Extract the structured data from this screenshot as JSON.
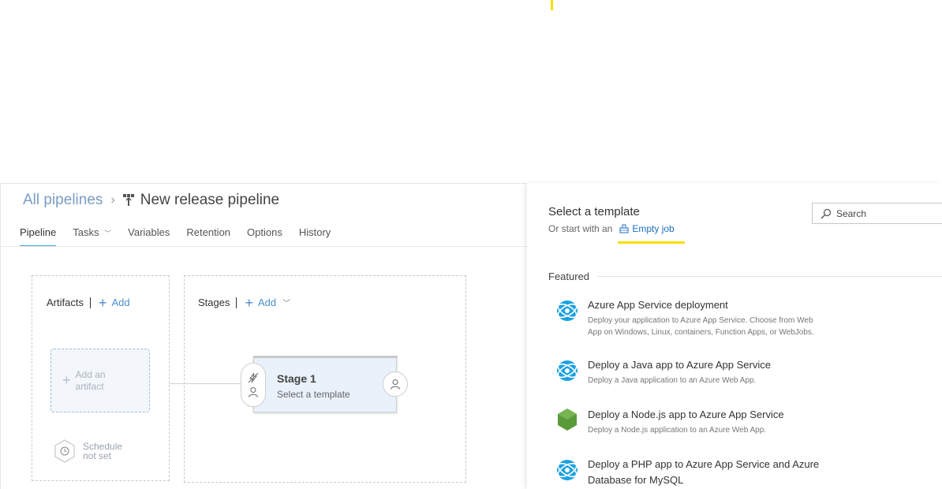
{
  "breadcrumb": {
    "root": "All pipelines",
    "separator": "›",
    "title": "New release pipeline"
  },
  "tabs": [
    {
      "label": "Pipeline",
      "active": true
    },
    {
      "label": "Tasks",
      "active": false
    },
    {
      "label": "Variables",
      "active": false
    },
    {
      "label": "Retention",
      "active": false
    },
    {
      "label": "Options",
      "active": false
    },
    {
      "label": "History",
      "active": false
    }
  ],
  "artifacts": {
    "heading": "Artifacts",
    "add_label": "Add",
    "card_line1": "Add an",
    "card_line2": "artifact",
    "schedule_line1": "Schedule",
    "schedule_line2": "not set"
  },
  "stages": {
    "heading": "Stages",
    "add_label": "Add",
    "stage_name": "Stage 1",
    "stage_sub": "Select a template"
  },
  "template_panel": {
    "title": "Select a template",
    "start_text": "Or start with an",
    "empty_job": "Empty job",
    "search_placeholder": "Search",
    "featured": "Featured",
    "templates": [
      {
        "name": "Azure App Service deployment",
        "desc": "Deploy your application to Azure App Service. Choose from Web App on Windows, Linux, containers, Function Apps, or WebJobs.",
        "icon": "azure-app-service-icon"
      },
      {
        "name": "Deploy a Java app to Azure App Service",
        "desc": "Deploy a Java application to an Azure Web App.",
        "icon": "azure-app-service-icon"
      },
      {
        "name": "Deploy a Node.js app to Azure App Service",
        "desc": "Deploy a Node.js application to an Azure Web App.",
        "icon": "nodejs-icon"
      },
      {
        "name": "Deploy a PHP app to Azure App Service and Azure Database for MySQL",
        "desc": "",
        "icon": "azure-app-service-icon"
      }
    ]
  },
  "colors": {
    "accent": "#4a8fd0",
    "highlight": "#f5e000",
    "stage_bg": "#e9f1fb",
    "azure_blue": "#1ba1e2",
    "node_green": "#5b9a3a"
  }
}
